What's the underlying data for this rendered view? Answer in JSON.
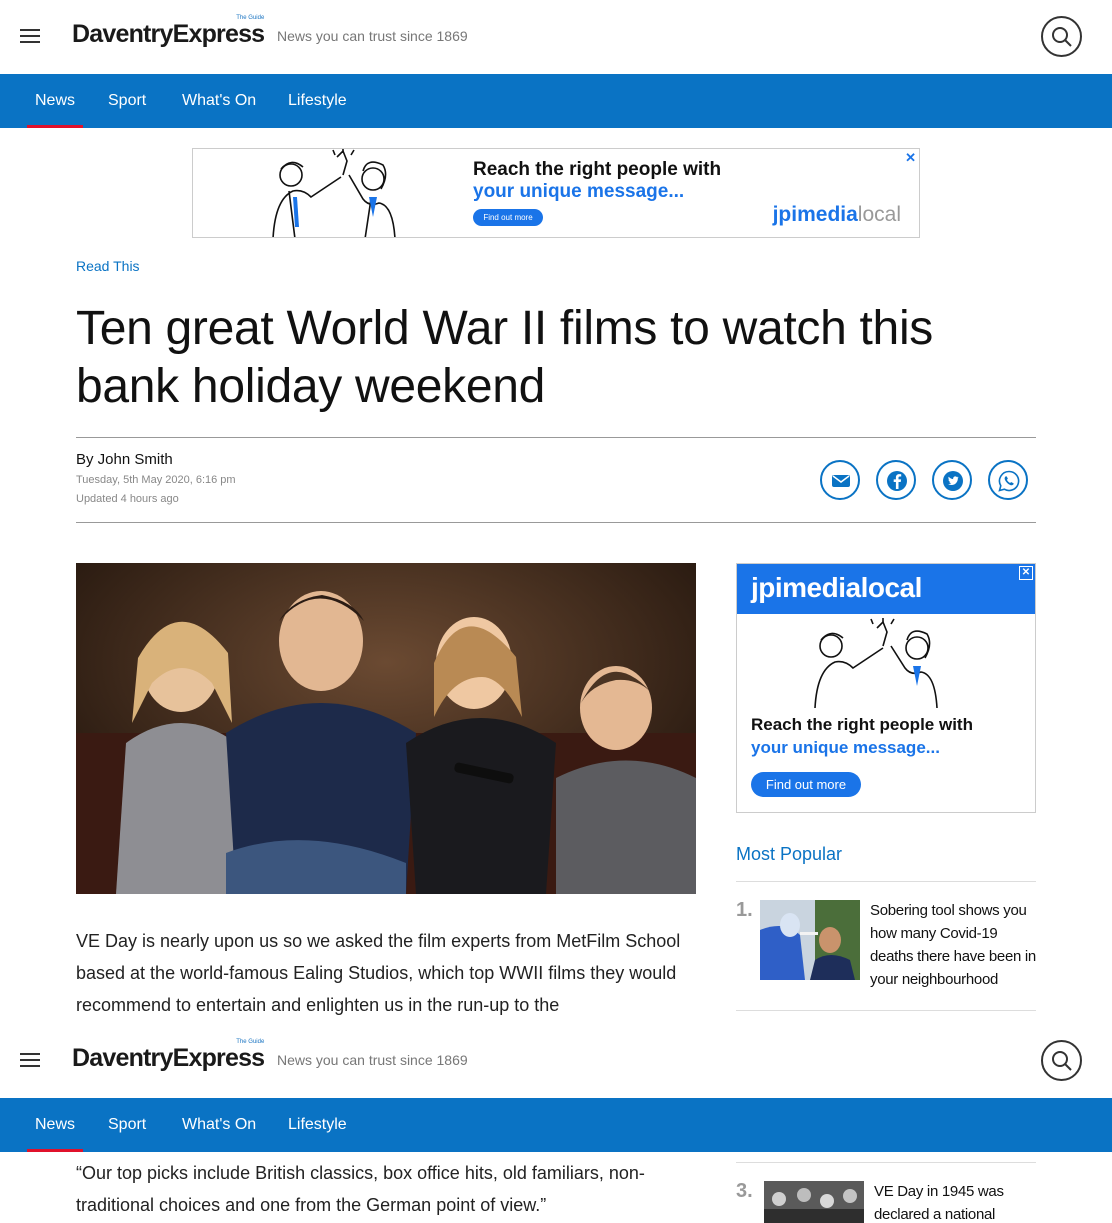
{
  "header": {
    "logo": "DaventryExpress",
    "logo_small": "The Guide",
    "tagline": "News you can trust since 1869"
  },
  "nav": {
    "items": [
      {
        "label": "News",
        "active": true
      },
      {
        "label": "Sport",
        "active": false
      },
      {
        "label": "What's On",
        "active": false
      },
      {
        "label": "Lifestyle",
        "active": false
      }
    ]
  },
  "ad_top": {
    "headline": "Reach the right people with",
    "sub": "your unique message...",
    "cta": "Find out more",
    "brand_bold": "jpimedia",
    "brand_light": "local",
    "close": "✕"
  },
  "article": {
    "section": "Read This",
    "title": "Ten great World War II films to watch this bank holiday weekend",
    "byline": "By John Smith",
    "date": "Tuesday, 5th May 2020, 6:16 pm",
    "updated": "Updated  4 hours ago",
    "para1": "VE Day is nearly upon us so we asked the film experts from MetFilm School based at the world-famous Ealing Studios, which top WWII films they would recommend to entertain and enlighten us in the run-up to the",
    "para2": "“Our top picks include British classics, box office hits, old familiars, non-traditional choices and one from the German point of view.”"
  },
  "ad_side": {
    "brand": "jpimedialocal",
    "headline": "Reach the right people with",
    "sub": "your unique message...",
    "cta": "Find out more",
    "close": "✕"
  },
  "most_popular": {
    "title": "Most Popular",
    "items": [
      {
        "num": "1.",
        "text": "Sobering tool shows you how many Covid-19 deaths there have been in your neighbourhood"
      },
      {
        "num": "3.",
        "text": "VE Day in 1945 was declared a national"
      }
    ]
  },
  "colors": {
    "brand_blue": "#0a73c4",
    "active_red": "#e0112b",
    "ad_blue": "#1a74e8"
  }
}
